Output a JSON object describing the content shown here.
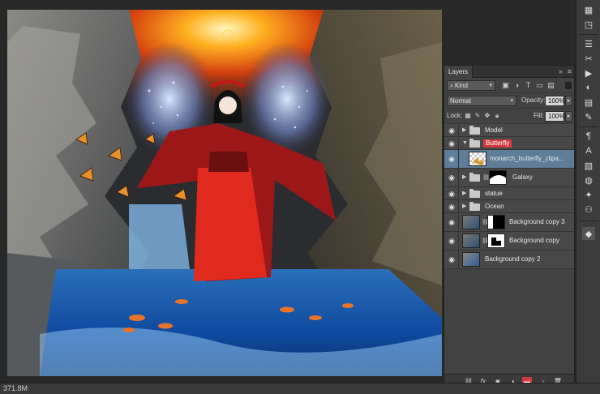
{
  "panel": {
    "tab_label": "Layers",
    "collapse_glyph": "»",
    "menu_glyph": "≡"
  },
  "filter": {
    "kind_label": "Kind",
    "icons": [
      "image-filter-icon",
      "adjustment-filter-icon",
      "type-filter-icon",
      "shape-filter-icon",
      "smart-object-filter-icon"
    ]
  },
  "blend": {
    "mode": "Normal",
    "opacity_label": "Opacity:",
    "opacity_value": "100%"
  },
  "lock": {
    "label": "Lock:",
    "fill_label": "Fill:",
    "fill_value": "100%"
  },
  "layers": [
    {
      "name": "Model",
      "type": "group",
      "expanded": false,
      "selected": false
    },
    {
      "name": "Butterfly",
      "type": "group",
      "expanded": true,
      "selected": false,
      "highlight": "#d23a3a"
    },
    {
      "name": "monarch_butterfly_clipa...",
      "type": "layer",
      "selected": true
    },
    {
      "name": "Galaxy",
      "type": "group-masked",
      "expanded": false,
      "selected": false
    },
    {
      "name": "statue",
      "type": "group",
      "expanded": false,
      "selected": false
    },
    {
      "name": "Ocean",
      "type": "group",
      "expanded": false,
      "selected": false
    },
    {
      "name": "Background copy 3",
      "type": "layer-masked",
      "selected": false
    },
    {
      "name": "Background copy",
      "type": "layer-masked",
      "selected": false
    },
    {
      "name": "Background copy 2",
      "type": "layer",
      "selected": false
    }
  ],
  "footer_icons": [
    "link-icon",
    "fx-icon",
    "add-mask-icon",
    "adjustment-layer-icon",
    "new-group-icon",
    "new-layer-icon",
    "trash-icon"
  ],
  "status": {
    "doc_size": "371.8M"
  },
  "colors": {
    "selected_row": "#5d7d98",
    "highlight_red": "#d23a3a",
    "panel_bg": "#424242"
  }
}
